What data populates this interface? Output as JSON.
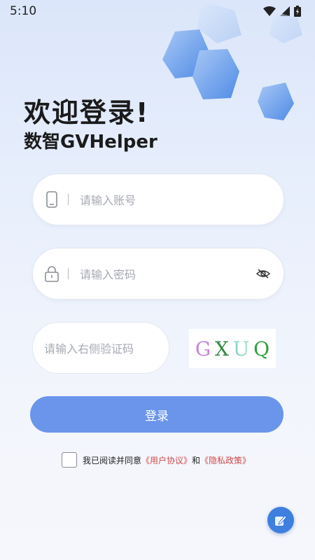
{
  "status_bar": {
    "time": "5:10"
  },
  "header": {
    "title": "欢迎登录!",
    "subtitle": "数智GVHelper"
  },
  "account": {
    "placeholder": "请输入账号",
    "icon": "phone-icon"
  },
  "password": {
    "placeholder": "请输入密码",
    "icon": "lock-icon",
    "toggle_icon": "eye-off-icon"
  },
  "captcha": {
    "placeholder": "请输入右侧验证码",
    "chars": [
      {
        "char": "G",
        "color": "#c685d9"
      },
      {
        "char": "X",
        "color": "#2f8a3f"
      },
      {
        "char": "U",
        "color": "#8fd8c6"
      },
      {
        "char": "Q",
        "color": "#2ca03c"
      }
    ]
  },
  "login_button": {
    "label": "登录",
    "color": "#6b95ea"
  },
  "agreement": {
    "prefix": "我已阅读并同意",
    "user_agreement": "《用户协议》",
    "and": "和",
    "privacy_policy": "《隐私政策》"
  },
  "floating_button": {
    "icon": "edit-icon"
  }
}
